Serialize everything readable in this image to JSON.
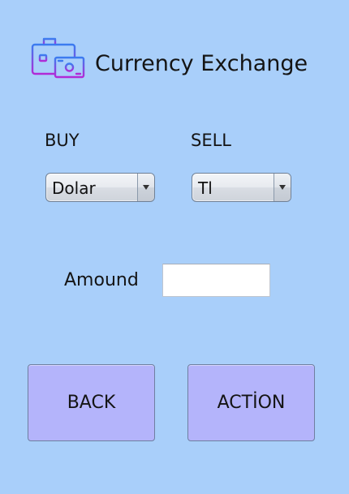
{
  "header": {
    "title": "Currency Exchange",
    "logo_icon": "briefcase-money-icon"
  },
  "buy": {
    "label": "BUY",
    "selected": "Dolar"
  },
  "sell": {
    "label": "SELL",
    "selected": "Tl"
  },
  "amount": {
    "label": "Amound",
    "value": ""
  },
  "buttons": {
    "back_label": "BACK",
    "action_label": "ACTİON"
  },
  "colors": {
    "background": "#a9cffa",
    "button": "#b4b4fb",
    "logo_gradient_start": "#3b7cf0",
    "logo_gradient_end": "#b22ad6"
  }
}
